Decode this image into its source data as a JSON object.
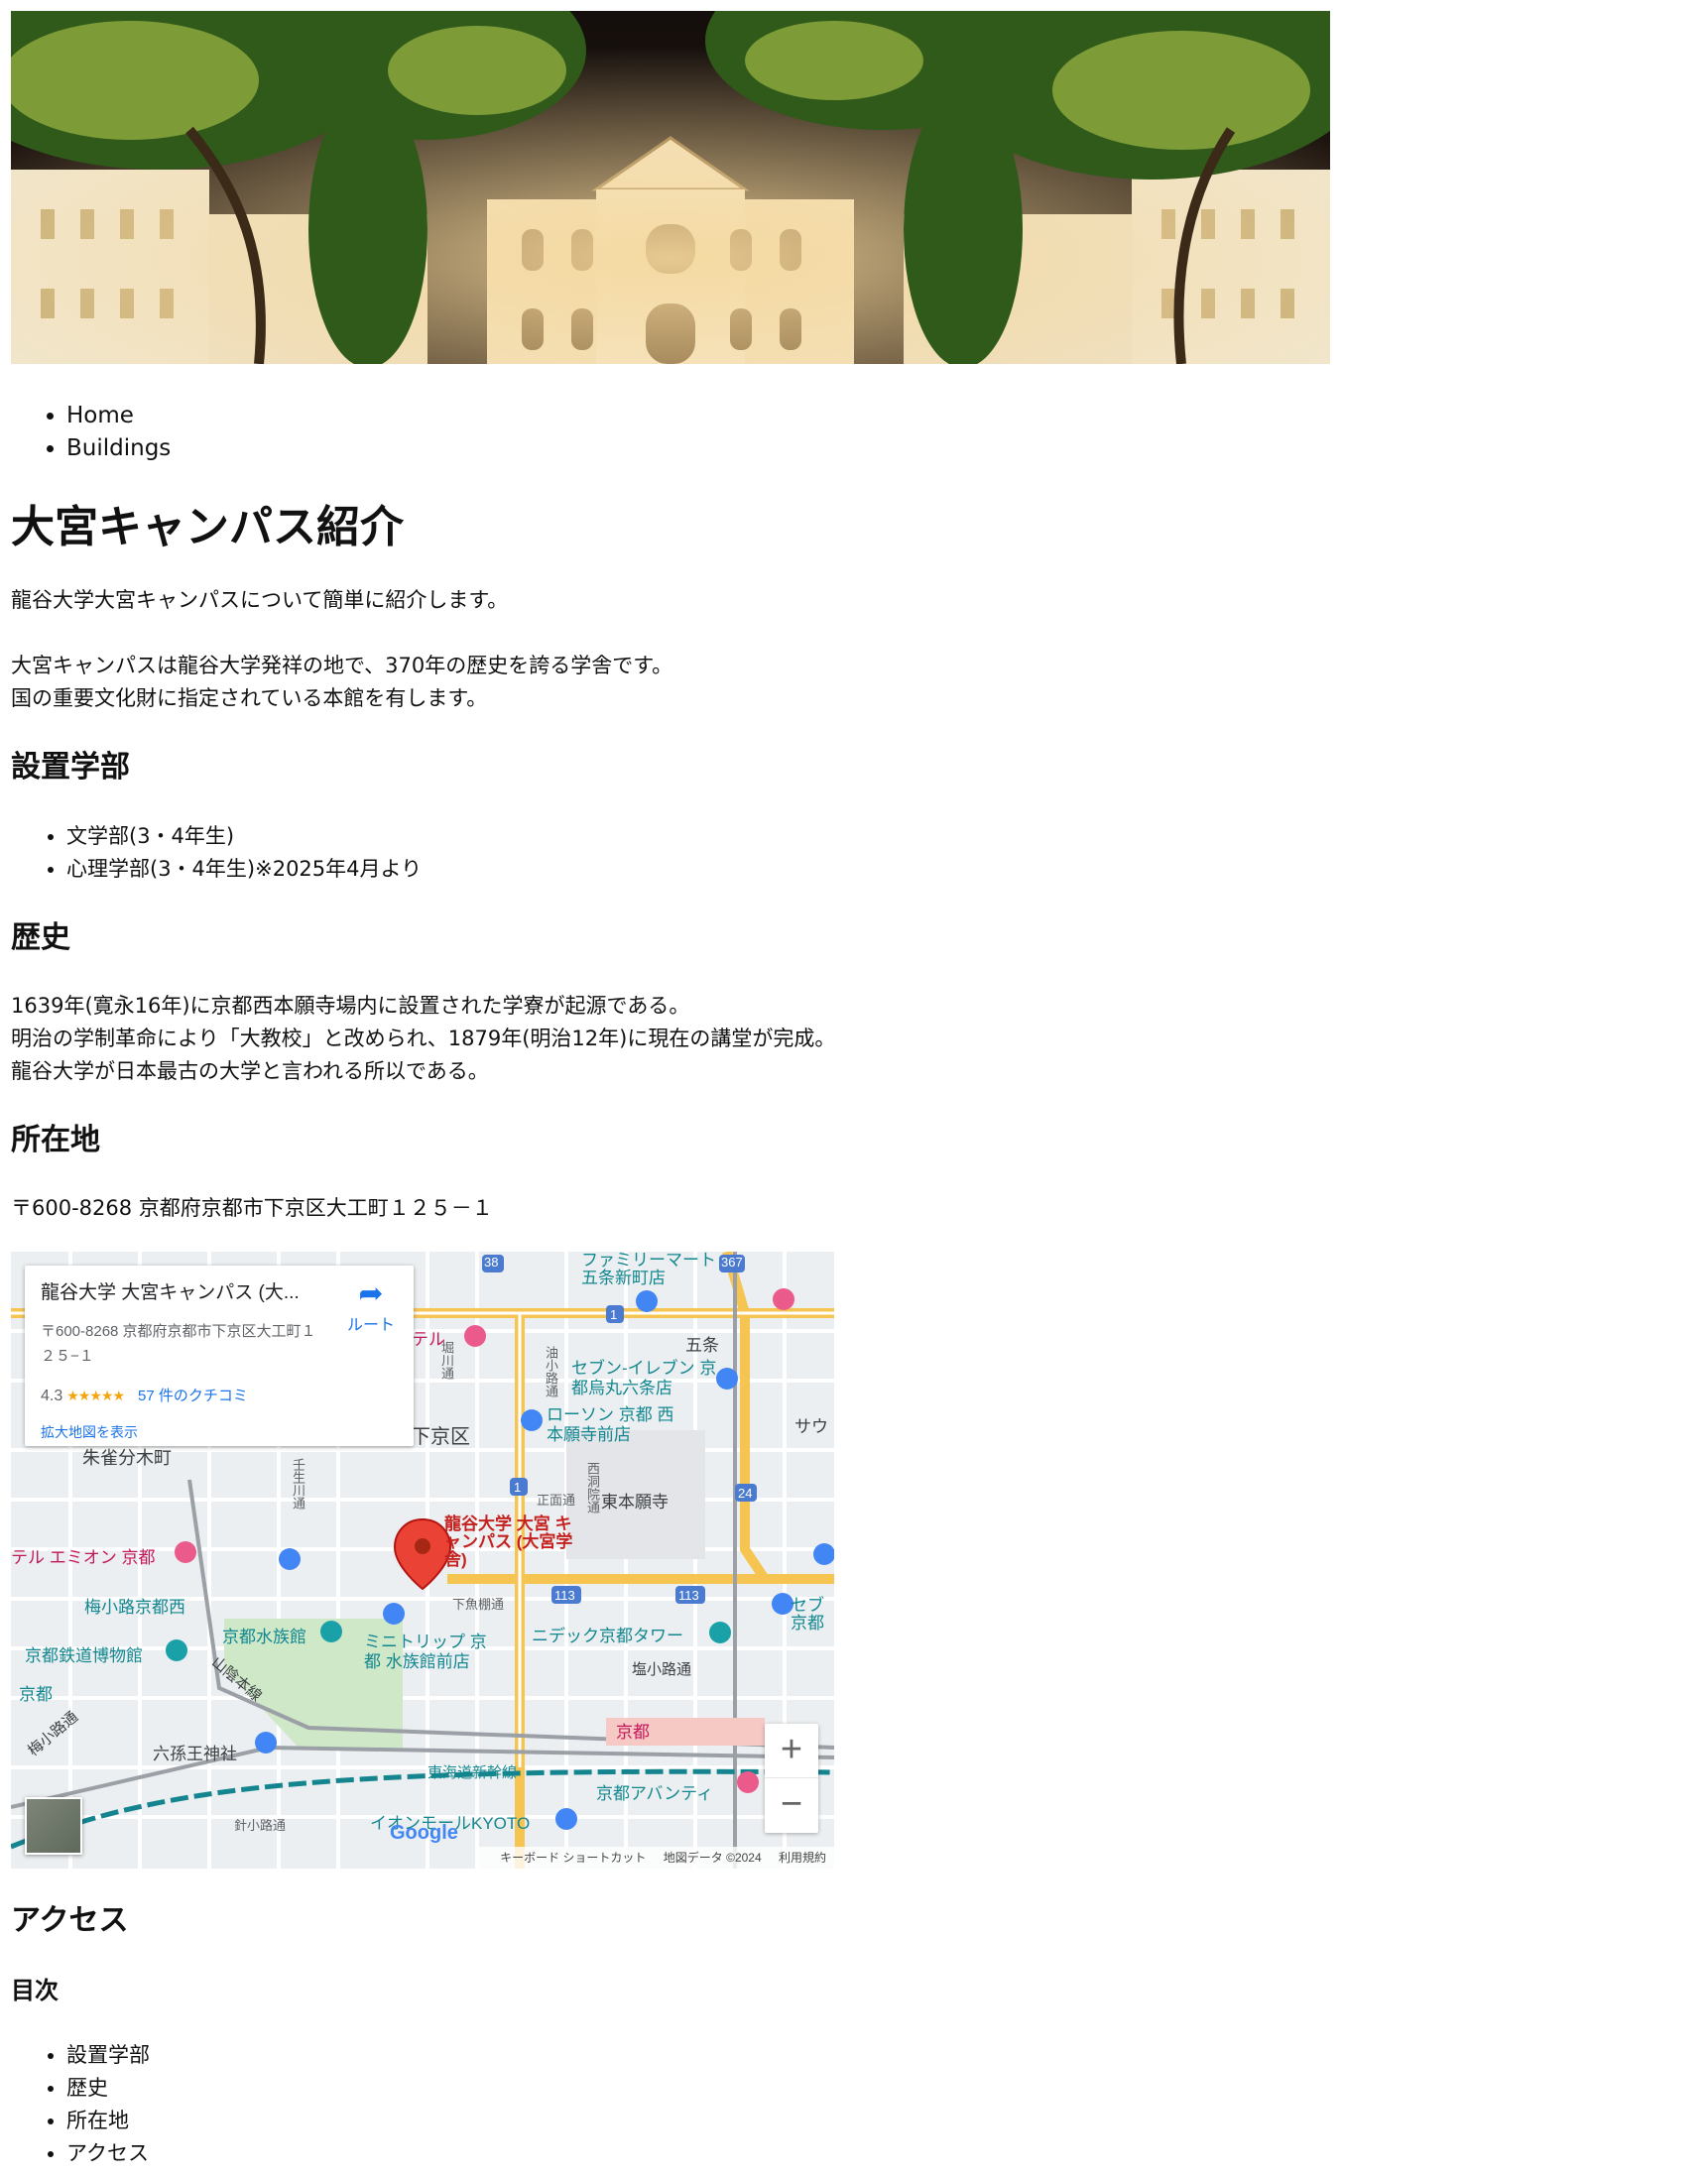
{
  "breadcrumb": {
    "items": [
      "Home",
      "Buildings"
    ]
  },
  "page": {
    "title": "大宮キャンパス紹介",
    "lead": "龍谷大学大宮キャンパスについて簡単に紹介します。",
    "intro_lines": [
      "大宮キャンパスは龍谷大学発祥の地で、370年の歴史を誇る学舎です。",
      "国の重要文化財に指定されている本館を有します。"
    ]
  },
  "faculties": {
    "heading": "設置学部",
    "items": [
      "文学部(3・4年生)",
      "心理学部(3・4年生)※2025年4月より"
    ]
  },
  "history": {
    "heading": "歴史",
    "lines": [
      "1639年(寛永16年)に京都西本願寺場内に設置された学寮が起源である。",
      "明治の学制革命により「大教校」と改められ、1879年(明治12年)に現在の講堂が完成。",
      "龍谷大学が日本最古の大学と言われる所以である。"
    ]
  },
  "location": {
    "heading": "所在地",
    "address": "〒600-8268 京都府京都市下京区大工町１２５－１"
  },
  "map": {
    "info": {
      "title": "龍谷大学 大宮キャンパス (大...",
      "address": "〒600-8268 京都府京都市下京区大工町１２５−１",
      "rating": "4.3",
      "stars": "★★★★★",
      "reviews": "57 件のクチコミ",
      "route": "ルート",
      "enlarge": "拡大地図を表示"
    },
    "pin_label": "龍谷大学 大宮 キャンパス (大宮学舎)",
    "labels": {
      "family": "ファミリーマート 五条新町店",
      "gojo": "五条",
      "seven": "セブン-イレブン 京都烏丸六条店",
      "lawson": "ローソン 京都 西本願寺前店",
      "shimogyo": "下京区",
      "suzaku": "朱雀分木町",
      "higashihonganji": "東本願寺",
      "aeon_hotel": "テル エミオン 京都",
      "umekoji": "梅小路京都西",
      "aquarium": "京都水族館",
      "minitrip": "ミニトリップ 京都 水族館前店",
      "tower": "ニデック京都タワー",
      "railway": "京都鉄道博物館",
      "kyoto": "京都",
      "kyoto_st": "京都",
      "shiokoji": "塩小路通",
      "rokuson": "六孫王神社",
      "shinkansen": "東海道新幹線",
      "avanti": "京都アバンティ",
      "aeonmall": "イオンモールKYOTO",
      "hotel": "テル",
      "sanin": "山陰本線",
      "umekoji_dori": "梅小路通",
      "hariko": "針小路通",
      "shimouo": "下魚棚通",
      "shomen": "正面通",
      "aburanokoji": "油小路通",
      "horikawa": "堀川通",
      "nishinotoin": "西洞院通",
      "mibu": "壬生川通",
      "r38": "38",
      "r367": "367",
      "r1": "1",
      "r1b": "1",
      "r24": "24",
      "r113a": "113",
      "r113b": "113",
      "sew": "サウ",
      "seven2": "セブ 京都"
    },
    "zoom_in": "+",
    "zoom_out": "−",
    "google": "Google",
    "attribution": [
      "キーボード ショートカット",
      "地図データ ©2024",
      "利用規約"
    ]
  },
  "access": {
    "heading": "アクセス"
  },
  "toc": {
    "heading": "目次",
    "items": [
      "設置学部",
      "歴史",
      "所在地",
      "アクセス"
    ]
  },
  "colors": {
    "link": "#1a73e8",
    "pin": "#ea4335",
    "road_major": "#fbc04a",
    "highway": "#f3c76a"
  }
}
